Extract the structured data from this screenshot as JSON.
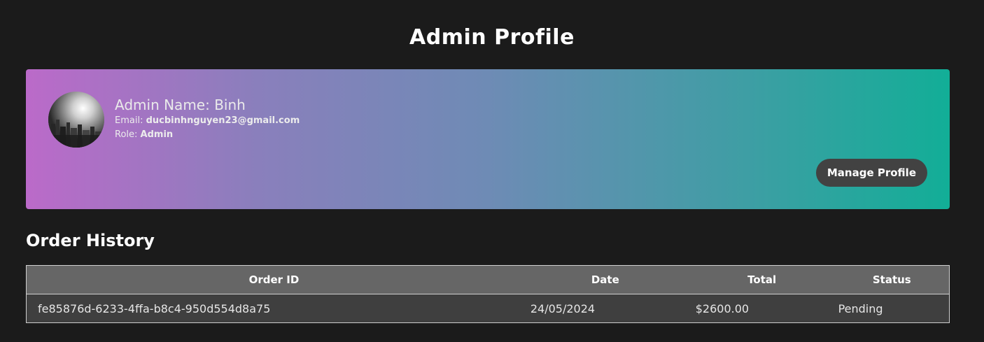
{
  "page": {
    "title": "Admin Profile"
  },
  "profile": {
    "name_label": "Admin Name: Binh",
    "email_label": "Email:",
    "email_value": "ducbinhnguyen23@gmail.com",
    "role_label": "Role:",
    "role_value": "Admin",
    "manage_button": "Manage Profile"
  },
  "orders": {
    "title": "Order History",
    "headers": {
      "order_id": "Order ID",
      "date": "Date",
      "total": "Total",
      "status": "Status"
    },
    "rows": [
      {
        "order_id": "fe85876d-6233-4ffa-b8c4-950d554d8a75",
        "date": "24/05/2024",
        "total": "$2600.00",
        "status": "Pending"
      }
    ]
  },
  "colors": {
    "background": "#1b1b1b",
    "gradient_start": "#bb6ac9",
    "gradient_end": "#12ae97",
    "button_bg": "#424242",
    "table_header_bg": "#666666",
    "table_row_bg": "#3f3f3f"
  }
}
